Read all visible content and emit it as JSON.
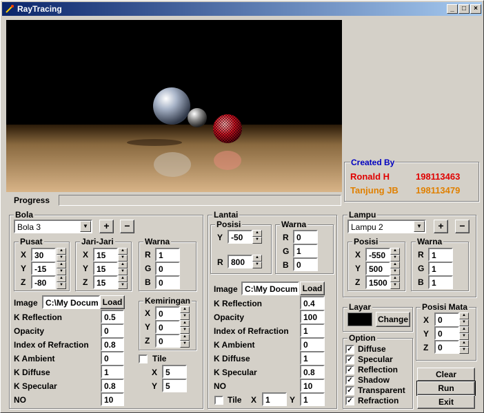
{
  "window": {
    "title": "RayTracing",
    "min": "_",
    "max": "□",
    "close": "×"
  },
  "created": {
    "heading": "Created By",
    "name1": "Ronald H",
    "id1": "198113463",
    "name2": "Tanjung JB",
    "id2": "198113479"
  },
  "progress_label": "Progress",
  "bola": {
    "title": "Bola",
    "selected": "Bola 3",
    "add": "+",
    "remove": "−",
    "pusat": {
      "title": "Pusat",
      "x_label": "X",
      "x": "30",
      "y_label": "Y",
      "y": "-15",
      "z_label": "Z",
      "z": "-80"
    },
    "jari": {
      "title": "Jari-Jari",
      "x_label": "X",
      "x": "15",
      "y_label": "Y",
      "y": "15",
      "z_label": "Z",
      "z": "15"
    },
    "warna": {
      "title": "Warna",
      "r_label": "R",
      "r": "1",
      "g_label": "G",
      "g": "0",
      "b_label": "B",
      "b": "0"
    },
    "image_label": "Image",
    "image_path": "C:\\My Docum",
    "load": "Load",
    "kref_label": "K Reflection",
    "kref": "0.5",
    "opac_label": "Opacity",
    "opac": "0",
    "ior_label": "Index of Refraction",
    "ior": "0.8",
    "kamb_label": "K Ambient",
    "kamb": "0",
    "kdif_label": "K Diffuse",
    "kdif": "1",
    "kspec_label": "K Specular",
    "kspec": "0.8",
    "no_label": "NO",
    "no": "10",
    "kemiringan": {
      "title": "Kemiringan",
      "x_label": "X",
      "x": "0",
      "y_label": "Y",
      "y": "0",
      "z_label": "Z",
      "z": "0"
    },
    "tile_label": "Tile",
    "tile_x_label": "X",
    "tile_x": "5",
    "tile_y_label": "Y",
    "tile_y": "5"
  },
  "lantai": {
    "title": "Lantai",
    "posisi": {
      "title": "Posisi",
      "y_label": "Y",
      "y": "-50",
      "r_label": "R",
      "r": "800"
    },
    "warna": {
      "title": "Warna",
      "r_label": "R",
      "r": "0",
      "g_label": "G",
      "g": "1",
      "b_label": "B",
      "b": "0"
    },
    "image_label": "Image",
    "image_path": "C:\\My Docum",
    "load": "Load",
    "kref_label": "K Reflection",
    "kref": "0.4",
    "opac_label": "Opacity",
    "opac": "100",
    "ior_label": "Index of Refraction",
    "ior": "1",
    "kamb_label": "K Ambient",
    "kamb": "0",
    "kdif_label": "K Diffuse",
    "kdif": "1",
    "kspec_label": "K Specular",
    "kspec": "0.8",
    "no_label": "NO",
    "no": "10",
    "tile_label": "Tile",
    "tile_x_label": "X",
    "tile_x": "1",
    "tile_y_label": "Y",
    "tile_y": "1"
  },
  "lampu": {
    "title": "Lampu",
    "selected": "Lampu 2",
    "add": "+",
    "remove": "−",
    "posisi": {
      "title": "Posisi",
      "x_label": "X",
      "x": "-550",
      "y_label": "Y",
      "y": "500",
      "z_label": "Z",
      "z": "1500"
    },
    "warna": {
      "title": "Warna",
      "r_label": "R",
      "r": "1",
      "g_label": "G",
      "g": "1",
      "b_label": "B",
      "b": "1"
    }
  },
  "layar": {
    "title": "Layar",
    "change": "Change",
    "color": "#000000"
  },
  "mata": {
    "title": "Posisi Mata",
    "x_label": "X",
    "x": "0",
    "y_label": "Y",
    "y": "0",
    "z_label": "Z",
    "z": "0"
  },
  "option": {
    "title": "Option",
    "items": [
      "Diffuse",
      "Specular",
      "Reflection",
      "Shadow",
      "Transparent",
      "Refraction"
    ]
  },
  "buttons": {
    "clear": "Clear",
    "run": "Run",
    "exit": "Exit"
  }
}
